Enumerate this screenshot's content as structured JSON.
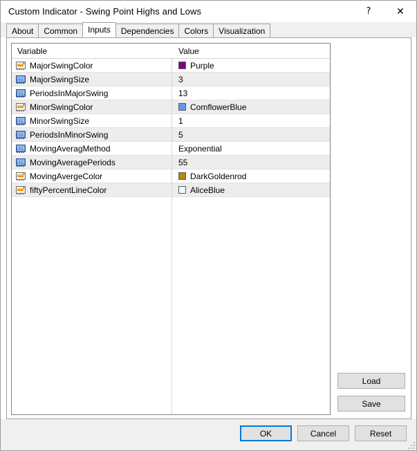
{
  "window": {
    "title": "Custom Indicator - Swing Point Highs and Lows",
    "help_glyph": "?",
    "close_glyph": "✕"
  },
  "tabs": [
    {
      "label": "About",
      "active": false
    },
    {
      "label": "Common",
      "active": false
    },
    {
      "label": "Inputs",
      "active": true
    },
    {
      "label": "Dependencies",
      "active": false
    },
    {
      "label": "Colors",
      "active": false
    },
    {
      "label": "Visualization",
      "active": false
    }
  ],
  "grid": {
    "columns": [
      "Variable",
      "Value"
    ],
    "rows": [
      {
        "icon": "color-swatch-icon",
        "variable": "MajorSwingColor",
        "value": "Purple",
        "swatch": "#800080"
      },
      {
        "icon": "number-123-icon",
        "variable": "MajorSwingSize",
        "value": "3",
        "swatch": null
      },
      {
        "icon": "number-123-icon",
        "variable": "PeriodsInMajorSwing",
        "value": "13",
        "swatch": null
      },
      {
        "icon": "color-swatch-icon",
        "variable": "MinorSwingColor",
        "value": "ComflowerBlue",
        "swatch": "#6495ed"
      },
      {
        "icon": "number-123-icon",
        "variable": "MinorSwingSize",
        "value": "1",
        "swatch": null
      },
      {
        "icon": "number-123-icon",
        "variable": "PeriodsInMinorSwing",
        "value": "5",
        "swatch": null
      },
      {
        "icon": "number-123-icon",
        "variable": "MovingAveragMethod",
        "value": "Exponential",
        "swatch": null
      },
      {
        "icon": "number-123-icon",
        "variable": "MovingAveragePeriods",
        "value": "55",
        "swatch": null
      },
      {
        "icon": "color-swatch-icon",
        "variable": "MovingAvergeColor",
        "value": "DarkGoldenrod",
        "swatch": "#b8860b"
      },
      {
        "icon": "color-swatch-icon",
        "variable": "fiftyPercentLineColor",
        "value": "AliceBlue",
        "swatch": "#f0f8ff"
      }
    ]
  },
  "side_buttons": [
    {
      "label": "Load"
    },
    {
      "label": "Save"
    }
  ],
  "footer_buttons": [
    {
      "label": "OK",
      "default": true
    },
    {
      "label": "Cancel",
      "default": false
    },
    {
      "label": "Reset",
      "default": false
    }
  ]
}
